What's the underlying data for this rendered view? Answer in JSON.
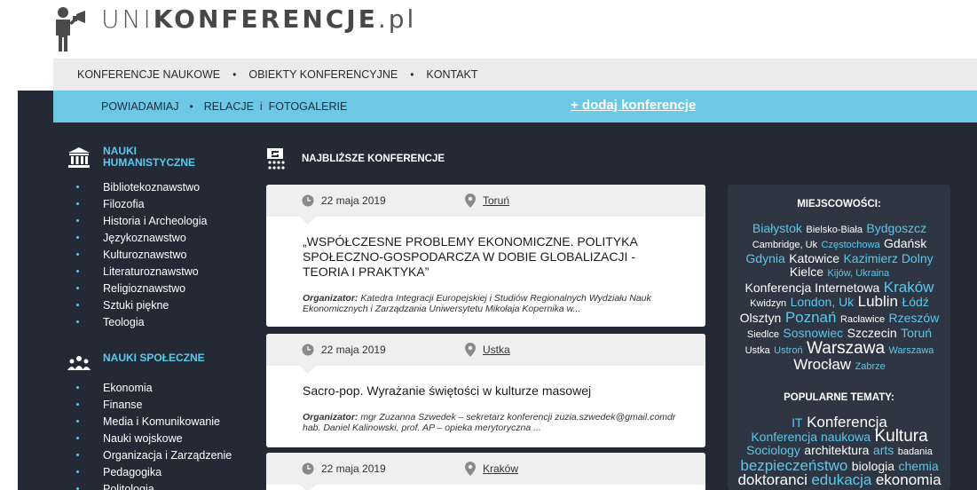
{
  "header": {
    "logo_prefix": "UNI",
    "logo_main": "KONFERENCJE",
    "logo_suffix": ".pl"
  },
  "main_nav": {
    "items": [
      "KONFERENCJE NAUKOWE",
      "OBIEKTY KONFERENCYJNE",
      "KONTAKT"
    ],
    "separator": "•"
  },
  "sub_nav": {
    "items": [
      "POWIADAMIAJ",
      "RELACJE  i  FOTOGALERIE"
    ],
    "separator": "•",
    "add_conference": "+ dodaj konferencje"
  },
  "sidebar": {
    "humanities": {
      "icon": "columns-building-icon",
      "title": "NAUKI HUMANISTYCZNE",
      "items": [
        "Bibliotekoznawstwo",
        "Filozofia",
        "Historia i Archeologia",
        "Językoznawstwo",
        "Kulturoznawstwo",
        "Literaturoznawstwo",
        "Religioznawstwo",
        "Sztuki piękne",
        "Teologia"
      ]
    },
    "social": {
      "icon": "people-group-icon",
      "title": "NAUKI SPOŁECZNE",
      "items": [
        "Ekonomia",
        "Finanse",
        "Media i Komunikowanie",
        "Nauki wojskowe",
        "Organizacja i Zarządzenie",
        "Pedagogika",
        "Politologia"
      ]
    }
  },
  "center": {
    "title": "NAJBLIŻSZE KONFERENCJE",
    "icon": "presenter-audience-icon",
    "cards": [
      {
        "date": "22 maja 2019",
        "city": "Toruń",
        "title": "„WSPÓŁCZESNE PROBLEMY EKONOMICZNE. POLITYKA SPOŁECZNO-GOSPODARCZA W DOBIE GLOBALIZACJI - TEORIA I PRAKTYKA”",
        "org_label": "Organizator:",
        "org_text": "Katedra Integracji Europejskiej i Studiów Regionalnych Wydziału Nauk Ekonomicznych i Zarządzania Uniwersytetu Mikołaja Kopernika w..."
      },
      {
        "date": "22 maja 2019",
        "city": "Ustka",
        "title": "Sacro-pop. Wyrażanie świętości w kulturze masowej",
        "org_label": "Organizator:",
        "org_text": "mgr Zuzanna Szwedek – sekretarz konferencji zuzia.szwedek@gmail.comdr hab. Daniel Kalinowski, prof. AP – opieka merytoryczna ..."
      },
      {
        "date": "22 maja 2019",
        "city": "Kraków",
        "title": "",
        "org_label": "",
        "org_text": ""
      }
    ]
  },
  "right": {
    "places_title": "MIEJSCOWOŚCI:",
    "places": [
      {
        "t": "Białystok",
        "s": 14,
        "c": "#5cc8ec"
      },
      {
        "t": "Bielsko-Biała",
        "s": 11,
        "c": "#ffffff"
      },
      {
        "t": "Bydgoszcz",
        "s": 14,
        "c": "#5cc8ec"
      },
      {
        "t": "Cambridge, Uk",
        "s": 11,
        "c": "#ffffff"
      },
      {
        "t": "Częstochowa",
        "s": 11,
        "c": "#5cc8ec"
      },
      {
        "t": "Gdańsk",
        "s": 14,
        "c": "#ffffff"
      },
      {
        "t": "Gdynia",
        "s": 14,
        "c": "#5cc8ec"
      },
      {
        "t": "Katowice",
        "s": 14,
        "c": "#ffffff"
      },
      {
        "t": "Kazimierz Dolny",
        "s": 14,
        "c": "#5cc8ec"
      },
      {
        "t": "Kielce",
        "s": 14,
        "c": "#ffffff"
      },
      {
        "t": "Kijów, Ukraina",
        "s": 11,
        "c": "#5cc8ec"
      },
      {
        "t": "Konferencja Internetowa",
        "s": 14,
        "c": "#ffffff"
      },
      {
        "t": "Kraków",
        "s": 17,
        "c": "#5cc8ec"
      },
      {
        "t": "Kwidzyn",
        "s": 11,
        "c": "#ffffff"
      },
      {
        "t": "London, Uk",
        "s": 14,
        "c": "#5cc8ec"
      },
      {
        "t": "Lublin",
        "s": 17,
        "c": "#ffffff"
      },
      {
        "t": "Łódź",
        "s": 14,
        "c": "#5cc8ec"
      },
      {
        "t": "Olsztyn",
        "s": 14,
        "c": "#ffffff"
      },
      {
        "t": "Poznań",
        "s": 17,
        "c": "#5cc8ec"
      },
      {
        "t": "Racławice",
        "s": 11,
        "c": "#ffffff"
      },
      {
        "t": "Rzeszów",
        "s": 14,
        "c": "#5cc8ec"
      },
      {
        "t": "Siedlce",
        "s": 11,
        "c": "#ffffff"
      },
      {
        "t": "Sosnowiec",
        "s": 14,
        "c": "#5cc8ec"
      },
      {
        "t": "Szczecin",
        "s": 14,
        "c": "#ffffff"
      },
      {
        "t": "Toruń",
        "s": 14,
        "c": "#5cc8ec"
      },
      {
        "t": "Ustka",
        "s": 11,
        "c": "#ffffff"
      },
      {
        "t": "Ustroń",
        "s": 11,
        "c": "#5cc8ec"
      },
      {
        "t": "Warszawa",
        "s": 19,
        "c": "#ffffff"
      },
      {
        "t": "Warszawa",
        "s": 11,
        "c": "#5cc8ec"
      },
      {
        "t": "Wrocław",
        "s": 17,
        "c": "#ffffff"
      },
      {
        "t": "Zabrze",
        "s": 11,
        "c": "#5cc8ec"
      }
    ],
    "topics_title": "POPULARNE TEMATY:",
    "topics": [
      {
        "t": "IT",
        "s": 14,
        "c": "#5cc8ec"
      },
      {
        "t": "Konferencja",
        "s": 17,
        "c": "#ffffff"
      },
      {
        "t": "Konferencja naukowa",
        "s": 14,
        "c": "#5cc8ec"
      },
      {
        "t": "Kultura",
        "s": 19,
        "c": "#ffffff"
      },
      {
        "t": "Sociology",
        "s": 14,
        "c": "#5cc8ec"
      },
      {
        "t": "architektura",
        "s": 14,
        "c": "#ffffff"
      },
      {
        "t": "arts",
        "s": 14,
        "c": "#5cc8ec"
      },
      {
        "t": "badania",
        "s": 11,
        "c": "#ffffff"
      },
      {
        "t": "bezpieczeństwo",
        "s": 17,
        "c": "#5cc8ec"
      },
      {
        "t": "biologia",
        "s": 14,
        "c": "#ffffff"
      },
      {
        "t": "chemia",
        "s": 14,
        "c": "#5cc8ec"
      },
      {
        "t": "doktoranci",
        "s": 17,
        "c": "#ffffff"
      },
      {
        "t": "edukacja",
        "s": 17,
        "c": "#5cc8ec"
      },
      {
        "t": "ekonomia",
        "s": 17,
        "c": "#ffffff"
      }
    ]
  }
}
